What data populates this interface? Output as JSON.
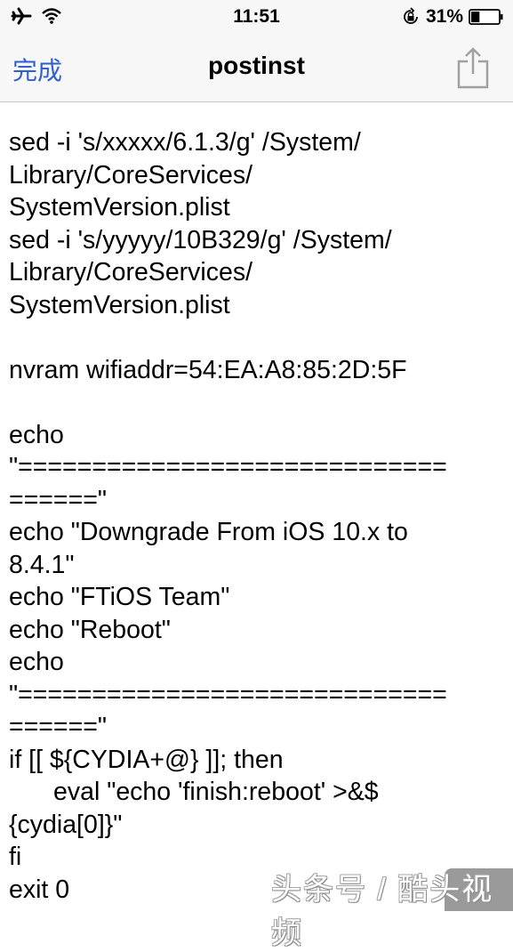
{
  "status_bar": {
    "time": "11:51",
    "battery_percent": "31%",
    "battery_level": 0.31,
    "icons": [
      "airplane-icon",
      "wifi-icon",
      "rotation-lock-icon",
      "battery-icon"
    ]
  },
  "navbar": {
    "done_label": "完成",
    "title": "postinst",
    "share_icon": "share-icon"
  },
  "content": {
    "lines": [
      "sed -i 's/xxxxx/6.1.3/g' /System/",
      "Library/CoreServices/",
      "SystemVersion.plist",
      "sed -i 's/yyyyy/10B329/g' /System/",
      "Library/CoreServices/",
      "SystemVersion.plist",
      "",
      "nvram wifiaddr=54:EA:A8:85:2D:5F",
      "",
      "echo",
      "\"=============================",
      "======\"",
      "echo \"Downgrade From iOS 10.x to",
      "8.4.1\"",
      "echo \"FTiOS Team\"",
      "echo \"Reboot\"",
      "echo",
      "\"=============================",
      "======\"",
      "if [[ ${CYDIA+@} ]]; then",
      "eval \"echo 'finish:reboot' >&$",
      "{cydia[0]}\"",
      "fi",
      "exit 0"
    ]
  },
  "watermark": {
    "text": "头条号 / 酷头视频"
  },
  "colors": {
    "accent": "#2f5fd0",
    "bar_background": "#f7f7f7",
    "icon_gray": "#a0a0a0"
  }
}
